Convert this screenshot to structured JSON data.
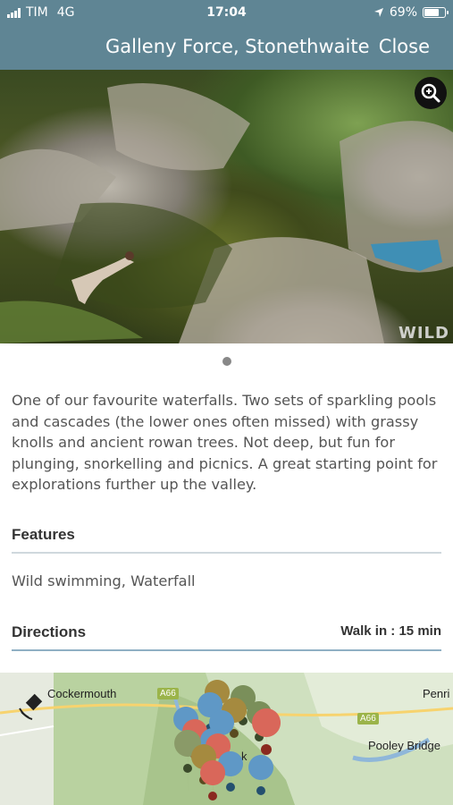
{
  "status_bar": {
    "carrier": "TIM",
    "network": "4G",
    "time": "17:04",
    "battery": "69%"
  },
  "nav": {
    "title": "Galleny Force, Stonethwaite",
    "close_label": "Close"
  },
  "photo": {
    "watermark": "WILD",
    "zoom_icon": "zoom-in-icon",
    "page_indicator": {
      "current": 1,
      "total": 1
    }
  },
  "description": "One of our favourite waterfalls. Two sets of sparkling pools and cascades (the lower ones often missed) with grassy knolls and ancient rowan trees. Not deep, but fun for plunging, snorkelling and picnics. A great starting point for explorations further up the valley.",
  "features": {
    "title": "Features",
    "text": "Wild swimming, Waterfall"
  },
  "directions": {
    "title": "Directions",
    "walk_label": "Walk in : 15 min"
  },
  "map": {
    "labels": {
      "cockermouth": "Cockermouth",
      "penrith": "Penri",
      "pooley_bridge": "Pooley Bridge",
      "keswick_fragment": "k"
    },
    "roads": {
      "a66_left": "A66",
      "a66_right": "A66"
    },
    "location_icon": "satellite-icon"
  },
  "colors": {
    "header": "#5f8594",
    "rule": "#8fb0c4",
    "text": "#555555"
  }
}
